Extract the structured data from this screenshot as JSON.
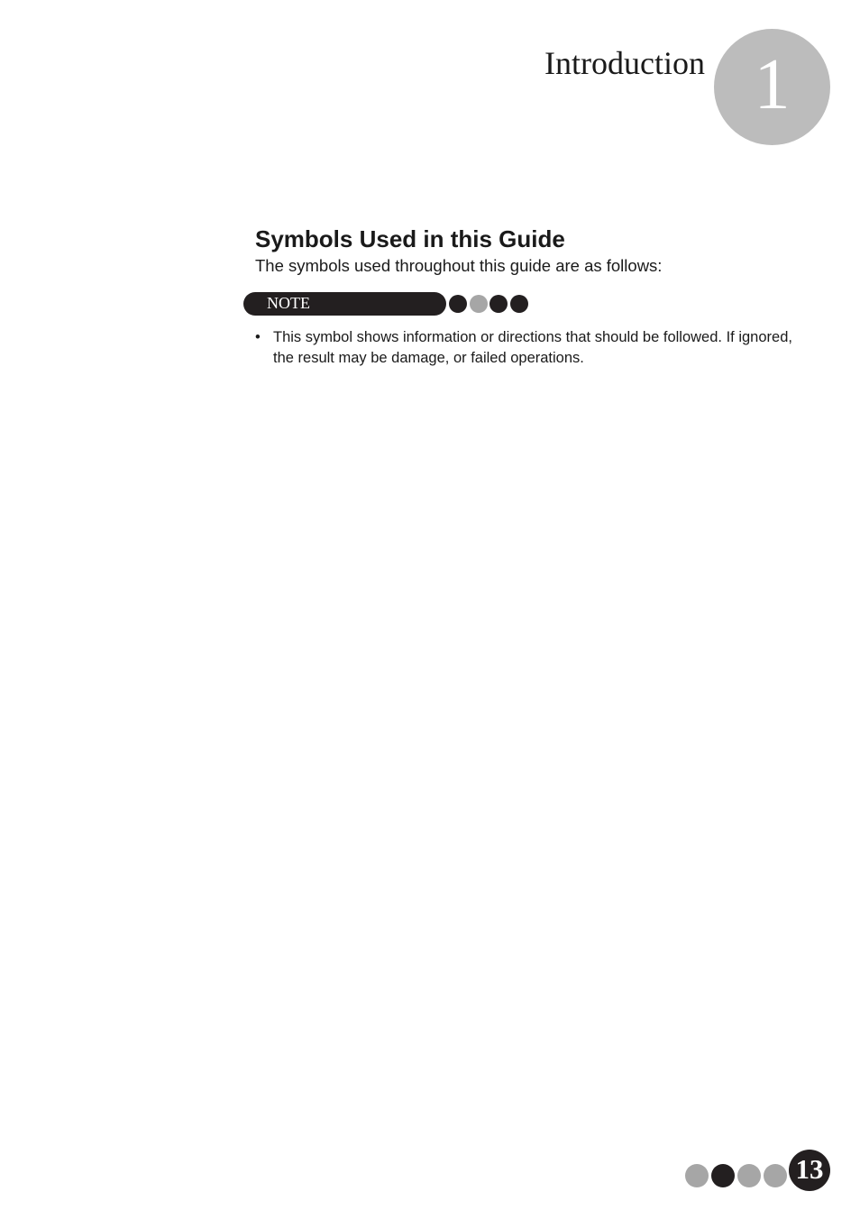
{
  "chapter": {
    "title": "Introduction",
    "number": "1"
  },
  "section": {
    "heading": "Symbols Used in this Guide",
    "intro": "The symbols used throughout this guide are as follows:"
  },
  "note_symbol": {
    "label": "NOTE",
    "dots": [
      "dark",
      "grey",
      "dark",
      "dark"
    ]
  },
  "bullets": [
    {
      "marker": "•",
      "text": "This symbol shows information or directions that should be followed. If ignored, the result may be damage, or failed operations."
    }
  ],
  "footer": {
    "page_number": "13",
    "dots": [
      "grey",
      "dark",
      "grey",
      "grey"
    ]
  },
  "colors": {
    "dark": "#231f20",
    "grey": "#a6a6a6",
    "chapter_circle": "#bcbcbc"
  }
}
